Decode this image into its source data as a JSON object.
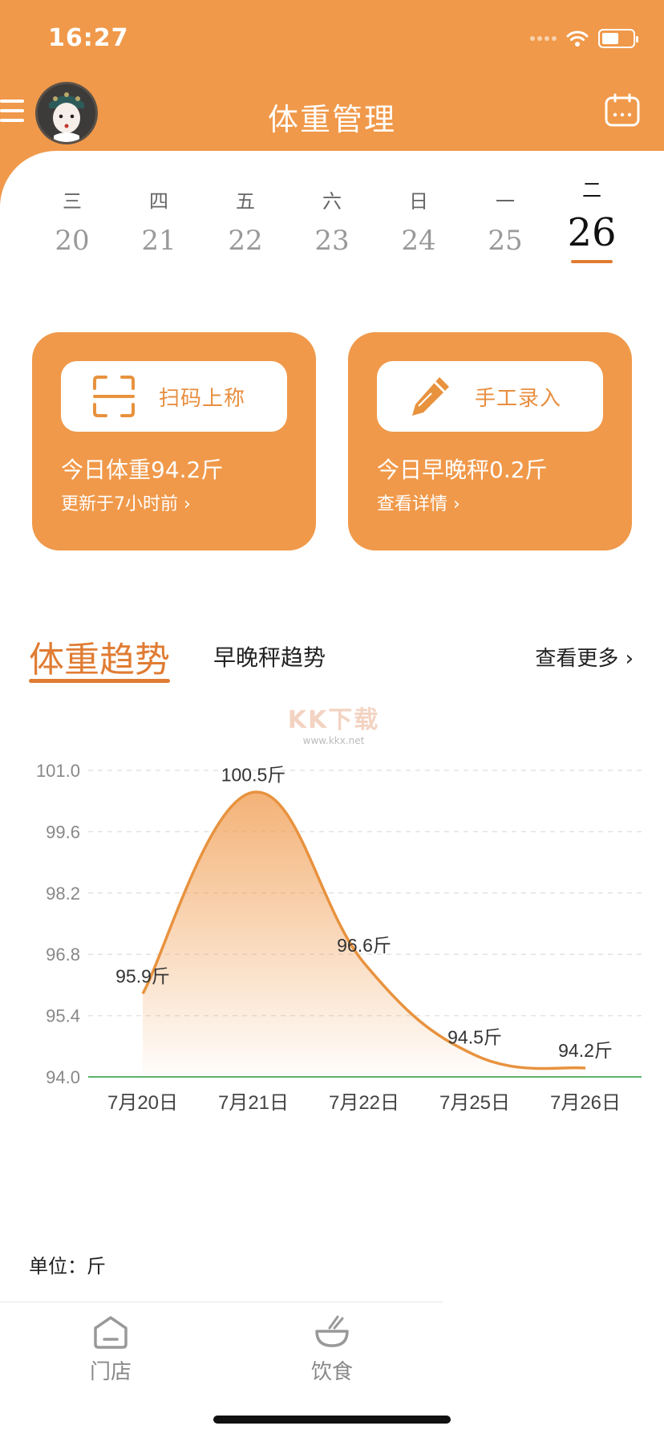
{
  "status_bar": {
    "time": "16:27"
  },
  "header": {
    "title": "体重管理"
  },
  "week": [
    {
      "weekday": "三",
      "date": "20",
      "active": false
    },
    {
      "weekday": "四",
      "date": "21",
      "active": false
    },
    {
      "weekday": "五",
      "date": "22",
      "active": false
    },
    {
      "weekday": "六",
      "date": "23",
      "active": false
    },
    {
      "weekday": "日",
      "date": "24",
      "active": false
    },
    {
      "weekday": "一",
      "date": "25",
      "active": false
    },
    {
      "weekday": "二",
      "date": "26",
      "active": true
    }
  ],
  "cards": {
    "scan": {
      "button_label": "扫码上称",
      "line1": "今日体重94.2斤",
      "line2": "更新于7小时前 ›"
    },
    "manual": {
      "button_label": "手工录入",
      "line1": "今日早晚秤0.2斤",
      "line2": "查看详情 ›"
    }
  },
  "trend": {
    "tab_active": "体重趋势",
    "tab_other": "早晚秤趋势",
    "see_more": "查看更多 ›"
  },
  "watermark": {
    "line1": "KK下载",
    "line2": "www.kkx.net"
  },
  "chart_data": {
    "type": "area",
    "categories": [
      "7月20日",
      "7月21日",
      "7月22日",
      "7月25日",
      "7月26日"
    ],
    "values": [
      95.9,
      100.5,
      96.6,
      94.5,
      94.2
    ],
    "data_labels": [
      "95.9斤",
      "100.5斤",
      "96.6斤",
      "94.5斤",
      "94.2斤"
    ],
    "y_ticks": [
      "94.0",
      "95.4",
      "96.8",
      "98.2",
      "99.6",
      "101.0"
    ],
    "ylim": [
      94.0,
      101.0
    ],
    "grid": true,
    "line_color": "#E8923E",
    "unit_label": "单位：斤"
  },
  "bottom_nav": [
    {
      "label": "门店",
      "icon": "store-icon"
    },
    {
      "label": "饮食",
      "icon": "bowl-icon"
    }
  ],
  "colors": {
    "accent": "#F0994A",
    "accent_dark": "#E07C33",
    "baseline": "#5CB36B"
  }
}
